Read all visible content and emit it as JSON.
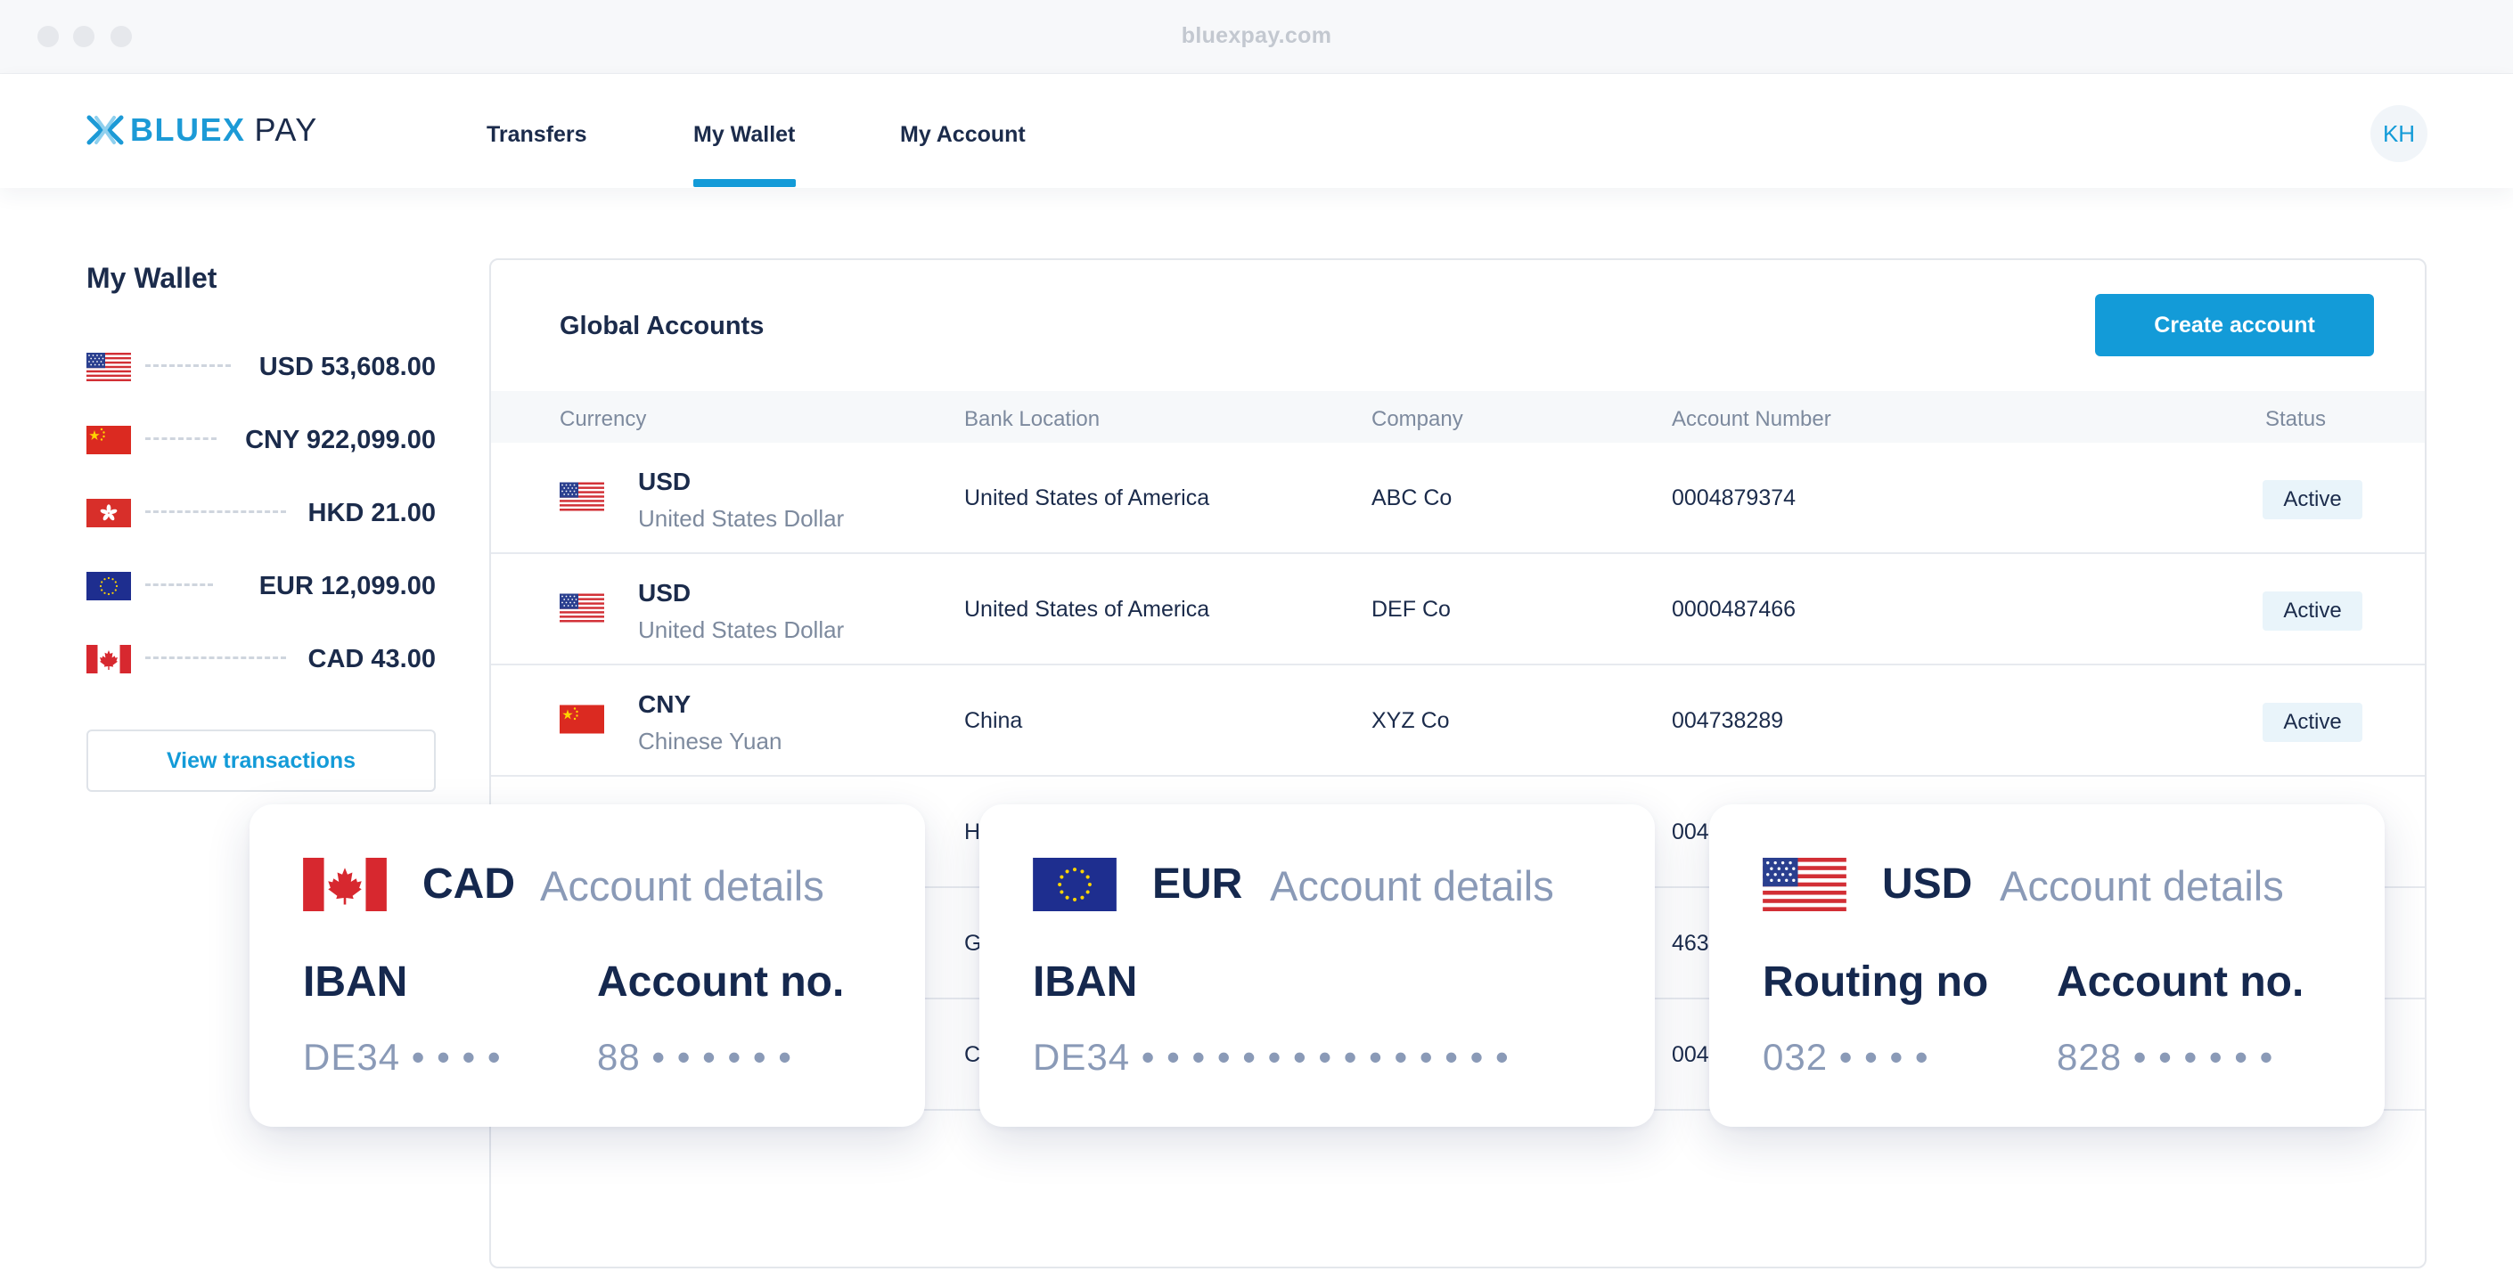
{
  "browser": {
    "url": "bluexpay.com"
  },
  "brand": {
    "name_part1": "BLUEX",
    "name_part2": "PAY",
    "accent": "#139bd8"
  },
  "nav": {
    "items": [
      {
        "label": "Transfers"
      },
      {
        "label": "My Wallet",
        "active": true
      },
      {
        "label": "My Account"
      }
    ]
  },
  "user": {
    "initials": "KH"
  },
  "sidebar": {
    "title": "My Wallet",
    "balances": [
      {
        "currency": "USD",
        "amount": "USD 53,608.00",
        "flag": "us-flag"
      },
      {
        "currency": "CNY",
        "amount": "CNY 922,099.00",
        "flag": "cn-flag"
      },
      {
        "currency": "HKD",
        "amount": "HKD 21.00",
        "flag": "hk-flag"
      },
      {
        "currency": "EUR",
        "amount": "EUR 12,099.00",
        "flag": "eu-flag"
      },
      {
        "currency": "CAD",
        "amount": "CAD 43.00",
        "flag": "ca-flag"
      }
    ],
    "view_transactions_label": "View transactions"
  },
  "accounts": {
    "title": "Global Accounts",
    "create_label": "Create account",
    "columns": [
      "Currency",
      "Bank Location",
      "Company",
      "Account Number",
      "Status"
    ],
    "rows": [
      {
        "code": "USD",
        "name": "United States Dollar",
        "location": "United States of America",
        "company": "ABC Co",
        "number": "0004879374",
        "status": "Active",
        "flag": "us-flag"
      },
      {
        "code": "USD",
        "name": "United States Dollar",
        "location": "United States of America",
        "company": "DEF Co",
        "number": "0000487466",
        "status": "Active",
        "flag": "us-flag"
      },
      {
        "code": "CNY",
        "name": "Chinese Yuan",
        "location": "China",
        "company": "XYZ Co",
        "number": "004738289",
        "status": "Active",
        "flag": "cn-flag"
      }
    ],
    "partial_rows": [
      {
        "location_fragment": "H",
        "number_fragment": "004"
      },
      {
        "location_fragment": "G",
        "number_fragment": "463"
      },
      {
        "location_fragment": "C",
        "number_fragment": "004"
      }
    ]
  },
  "cards": [
    {
      "code": "CAD",
      "subtitle": "Account details",
      "flag": "ca-flag",
      "fields": [
        {
          "label": "IBAN",
          "value": "DE34 • • • •"
        },
        {
          "label": "Account no.",
          "value": "88 • • • • • •"
        }
      ]
    },
    {
      "code": "EUR",
      "subtitle": "Account details",
      "flag": "eu-flag",
      "fields": [
        {
          "label": "IBAN",
          "value": "DE34 • • • • • • • • • • • • • • •"
        }
      ]
    },
    {
      "code": "USD",
      "subtitle": "Account details",
      "flag": "us-flag",
      "fields": [
        {
          "label": "Routing no",
          "value": "032 • • • •"
        },
        {
          "label": "Account no.",
          "value": "828 • • • • • •"
        }
      ]
    }
  ]
}
